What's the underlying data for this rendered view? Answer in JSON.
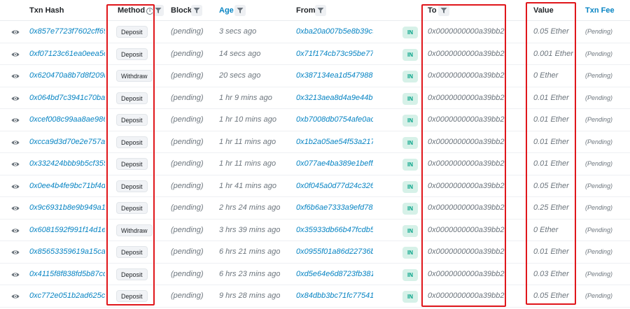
{
  "header": {
    "txn_hash": "Txn Hash",
    "method": "Method",
    "block": "Block",
    "age": "Age",
    "from": "From",
    "to": "To",
    "value": "Value",
    "txn_fee": "Txn Fee"
  },
  "icons": {
    "row_view": "eye-icon",
    "filter": "filter-icon",
    "info": "info-icon"
  },
  "colors": {
    "link": "#0784c3",
    "in_badge_bg": "#d6f1e8",
    "in_badge_text": "#00a186",
    "highlight": "#e0161b"
  },
  "rows": [
    {
      "hash": "0x857e7723f7602cff699...",
      "method": "Deposit",
      "block": "(pending)",
      "age": "3 secs ago",
      "from": "0xba20a007b5e8b39c96...",
      "direction": "IN",
      "to": "0x0000000000a39bb272...",
      "value": "0.05 Ether",
      "fee": "(Pending)"
    },
    {
      "hash": "0xf07123c61ea0eea5c5c...",
      "method": "Deposit",
      "block": "(pending)",
      "age": "14 secs ago",
      "from": "0x71f174cb73c95be77c4...",
      "direction": "IN",
      "to": "0x0000000000a39bb272...",
      "value": "0.001 Ether",
      "fee": "(Pending)"
    },
    {
      "hash": "0x620470a8b7d8f209b6...",
      "method": "Withdraw",
      "block": "(pending)",
      "age": "20 secs ago",
      "from": "0x387134ea1d5479889e...",
      "direction": "IN",
      "to": "0x0000000000a39bb272...",
      "value": "0 Ether",
      "fee": "(Pending)"
    },
    {
      "hash": "0x064bd7c3941c70bab9...",
      "method": "Deposit",
      "block": "(pending)",
      "age": "1 hr 9 mins ago",
      "from": "0x3213aea8d4a9e44b6f...",
      "direction": "IN",
      "to": "0x0000000000a39bb272...",
      "value": "0.01 Ether",
      "fee": "(Pending)"
    },
    {
      "hash": "0xcef008c99aa8ae986fb...",
      "method": "Deposit",
      "block": "(pending)",
      "age": "1 hr 10 mins ago",
      "from": "0xb7008db0754afe0acb...",
      "direction": "IN",
      "to": "0x0000000000a39bb272...",
      "value": "0.01 Ether",
      "fee": "(Pending)"
    },
    {
      "hash": "0xcca9d3d70e2e757abf...",
      "method": "Deposit",
      "block": "(pending)",
      "age": "1 hr 11 mins ago",
      "from": "0x1b2a05ae54f53a2178...",
      "direction": "IN",
      "to": "0x0000000000a39bb272...",
      "value": "0.01 Ether",
      "fee": "(Pending)"
    },
    {
      "hash": "0x332424bbb9b5cf355b...",
      "method": "Deposit",
      "block": "(pending)",
      "age": "1 hr 11 mins ago",
      "from": "0x077ae4ba389e1beff2c...",
      "direction": "IN",
      "to": "0x0000000000a39bb272...",
      "value": "0.01 Ether",
      "fee": "(Pending)"
    },
    {
      "hash": "0x0ee4b4fe9bc71bf4dca...",
      "method": "Deposit",
      "block": "(pending)",
      "age": "1 hr 41 mins ago",
      "from": "0x0f045a0d77d24c3263...",
      "direction": "IN",
      "to": "0x0000000000a39bb272...",
      "value": "0.05 Ether",
      "fee": "(Pending)"
    },
    {
      "hash": "0x9c6931b8e9b949a1c5...",
      "method": "Deposit",
      "block": "(pending)",
      "age": "2 hrs 24 mins ago",
      "from": "0xf6b6ae7333a9efd78b7...",
      "direction": "IN",
      "to": "0x0000000000a39bb272...",
      "value": "0.25 Ether",
      "fee": "(Pending)"
    },
    {
      "hash": "0x6081592f991f14d1eb9...",
      "method": "Withdraw",
      "block": "(pending)",
      "age": "3 hrs 39 mins ago",
      "from": "0x35933db66b47fcdb5d...",
      "direction": "IN",
      "to": "0x0000000000a39bb272...",
      "value": "0 Ether",
      "fee": "(Pending)"
    },
    {
      "hash": "0x85653359619a15cabd...",
      "method": "Deposit",
      "block": "(pending)",
      "age": "6 hrs 21 mins ago",
      "from": "0x0955f01a86d22736b8...",
      "direction": "IN",
      "to": "0x0000000000a39bb272...",
      "value": "0.01 Ether",
      "fee": "(Pending)"
    },
    {
      "hash": "0x4115f8f838fd5b87cdb9...",
      "method": "Deposit",
      "block": "(pending)",
      "age": "6 hrs 23 mins ago",
      "from": "0xd5e64e6d8723fb381e...",
      "direction": "IN",
      "to": "0x0000000000a39bb272...",
      "value": "0.03 Ether",
      "fee": "(Pending)"
    },
    {
      "hash": "0xc772e051b2ad625ce2...",
      "method": "Deposit",
      "block": "(pending)",
      "age": "9 hrs 28 mins ago",
      "from": "0x84dbb3bc71fc775414...",
      "direction": "IN",
      "to": "0x0000000000a39bb272...",
      "value": "0.05 Ether",
      "fee": "(Pending)"
    }
  ]
}
